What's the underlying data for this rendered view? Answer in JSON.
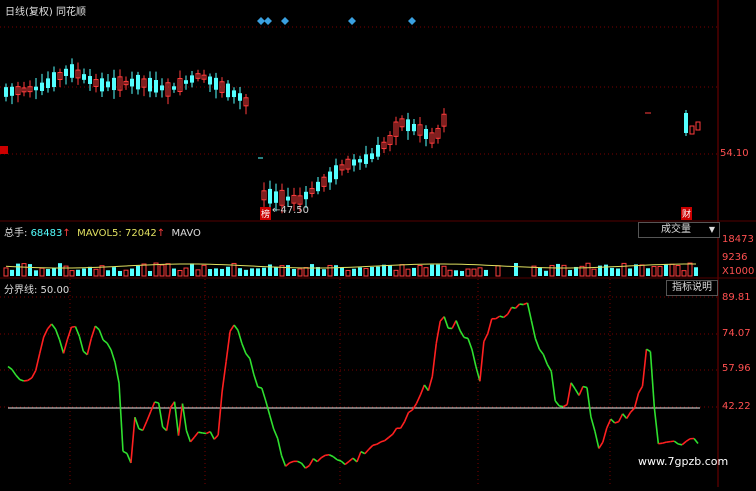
{
  "title": {
    "period": "日线(复权)",
    "source": "同花顺"
  },
  "price_panel": {
    "axis_label": "54.10",
    "low_label": "←47.50",
    "badge_left": "榜",
    "badge_right": "财"
  },
  "volume_panel": {
    "label": "总手:",
    "total": "68483",
    "arrow1": "↑",
    "mavol5_label": "MAVOL5:",
    "mavol5_value": "72042",
    "arrow2": "↑",
    "mavo_label": "MAVO",
    "dropdown_label": "成交量",
    "axis_top": "18473",
    "axis_mid": "9236",
    "axis_unit": "X1000"
  },
  "indicator_panel": {
    "label": "分界线: 50.00",
    "help_button": "指标说明",
    "axis_labels": [
      "89.81",
      "74.07",
      "57.96",
      "42.22"
    ],
    "watermark": "www.7gpzb.com",
    "chart_data": {
      "type": "line",
      "threshold": 50.0,
      "ylim": [
        26.4,
        93.8
      ],
      "values": [
        65.8,
        64.7,
        62.5,
        60.8,
        60.3,
        60.5,
        61.5,
        64.3,
        70.8,
        77.0,
        80.2,
        82.0,
        80.0,
        76.0,
        70.8,
        76.2,
        80.8,
        81.0,
        77.3,
        71.6,
        70.3,
        76.5,
        81.2,
        79.8,
        75.9,
        74.7,
        72.1,
        67.3,
        59.5,
        33.5,
        32.7,
        29.1,
        46.5,
        42.1,
        41.5,
        45.0,
        48.7,
        52.3,
        51.9,
        42.8,
        41.4,
        50.2,
        52.4,
        39.5,
        51.7,
        41.4,
        37.1,
        38.9,
        40.8,
        40.5,
        40.3,
        41.0,
        38.1,
        39.7,
        56.3,
        67.6,
        79.2,
        81.6,
        79.6,
        74.5,
        70.7,
        68.8,
        62.7,
        58.0,
        57.6,
        52.7,
        47.3,
        42.0,
        38.4,
        31.8,
        27.8,
        29.1,
        29.7,
        29.7,
        29.0,
        27.1,
        28.1,
        30.7,
        29.6,
        31.1,
        32.0,
        32.2,
        31.5,
        30.3,
        29.8,
        28.5,
        29.7,
        30.9,
        29.5,
        33.4,
        32.6,
        34.3,
        35.8,
        36.2,
        37.1,
        37.6,
        38.8,
        40.0,
        42.3,
        42.3,
        44.8,
        48.3,
        49.3,
        51.7,
        55.0,
        58.8,
        56.6,
        62.0,
        74.6,
        83.1,
        84.8,
        80.4,
        80.3,
        83.3,
        79.5,
        76.9,
        76.5,
        72.3,
        65.8,
        60.2,
        75.3,
        78.4,
        84.0,
        84.0,
        85.0,
        84.5,
        85.7,
        88.3,
        88.0,
        89.6,
        89.4,
        90.0,
        83.2,
        76.4,
        72.4,
        70.4,
        66.6,
        64.0,
        52.7,
        50.8,
        50.5,
        51.3,
        59.6,
        57.3,
        54.8,
        58.2,
        57.8,
        46.6,
        41.2,
        34.6,
        37.0,
        42.4,
        45.8,
        44.3,
        44.8,
        47.8,
        46.0,
        48.4,
        50.0,
        55.7,
        58.3,
        72.4,
        71.5,
        50.0,
        36.4,
        36.6,
        37.0,
        37.2,
        37.4,
        36.3,
        36.0,
        37.3,
        38.3,
        38.4,
        36.5
      ]
    }
  },
  "colors": {
    "up": "#ff3c3c",
    "down": "#54ffff",
    "osc_up": "#ff2020",
    "osc_down": "#2fe02f",
    "grid": "#7a0000",
    "ma": "#e0e060"
  }
}
